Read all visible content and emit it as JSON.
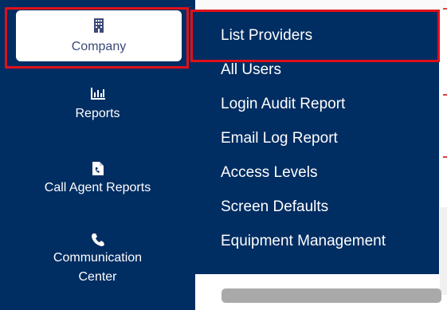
{
  "sidebar": {
    "company_label": "Company",
    "reports_label": "Reports",
    "call_agent_label": "Call Agent Reports",
    "communication_label": "Communication Center"
  },
  "dropdown": {
    "items": [
      "List Providers",
      "All Users",
      "Login Audit Report",
      "Email Log Report",
      "Access Levels",
      "Screen Defaults",
      "Equipment Management"
    ]
  },
  "colors": {
    "sidebar_bg": "#002d62",
    "highlight": "#e0101a",
    "company_text": "#3c4a7a"
  }
}
